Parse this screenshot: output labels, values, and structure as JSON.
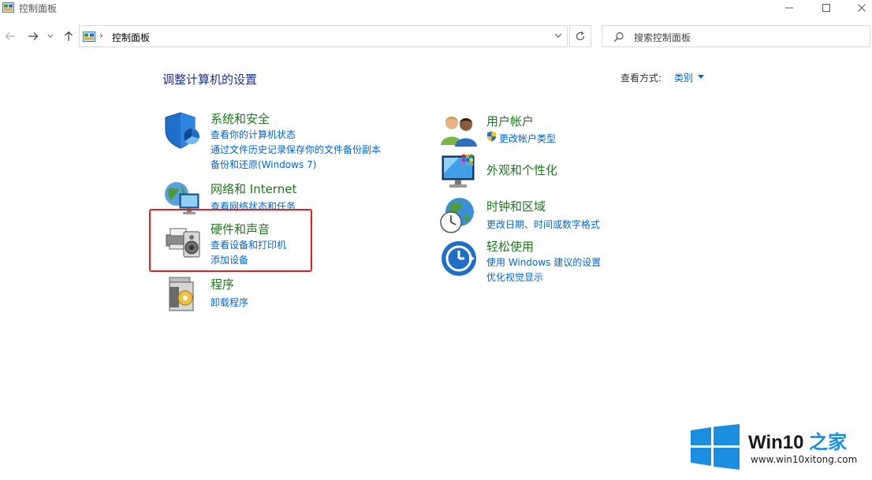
{
  "window": {
    "title": "控制面板"
  },
  "address": {
    "separator": "›",
    "location": "控制面板"
  },
  "search": {
    "placeholder": "搜索控制面板"
  },
  "content": {
    "heading": "调整计算机的设置",
    "view_by_label": "查看方式:",
    "view_by_value": "类别"
  },
  "categories": {
    "system_security": {
      "title": "系统和安全",
      "links": [
        "查看你的计算机状态",
        "通过文件历史记录保存你的文件备份副本",
        "备份和还原(Windows 7)"
      ]
    },
    "network": {
      "title": "网络和 Internet",
      "links": [
        "查看网络状态和任务"
      ]
    },
    "hardware": {
      "title": "硬件和声音",
      "links": [
        "查看设备和打印机",
        "添加设备"
      ]
    },
    "programs": {
      "title": "程序",
      "links": [
        "卸载程序"
      ]
    },
    "user_accounts": {
      "title": "用户帐户",
      "links": [
        "更改帐户类型"
      ]
    },
    "appearance": {
      "title": "外观和个性化",
      "links": []
    },
    "clock_region": {
      "title": "时钟和区域",
      "links": [
        "更改日期、时间或数字格式"
      ]
    },
    "ease_of_access": {
      "title": "轻松使用",
      "links": [
        "使用 Windows 建议的设置",
        "优化视觉显示"
      ]
    }
  },
  "watermark": {
    "brand_main": "Win10",
    "brand_accent": "之家",
    "url": "www.win10xitong.com"
  },
  "colors": {
    "link": "#0066cc",
    "category_title": "#1a7a1a",
    "heading": "#1e3287",
    "highlight": "#e02020",
    "windows_blue": "#1b8ee0"
  }
}
